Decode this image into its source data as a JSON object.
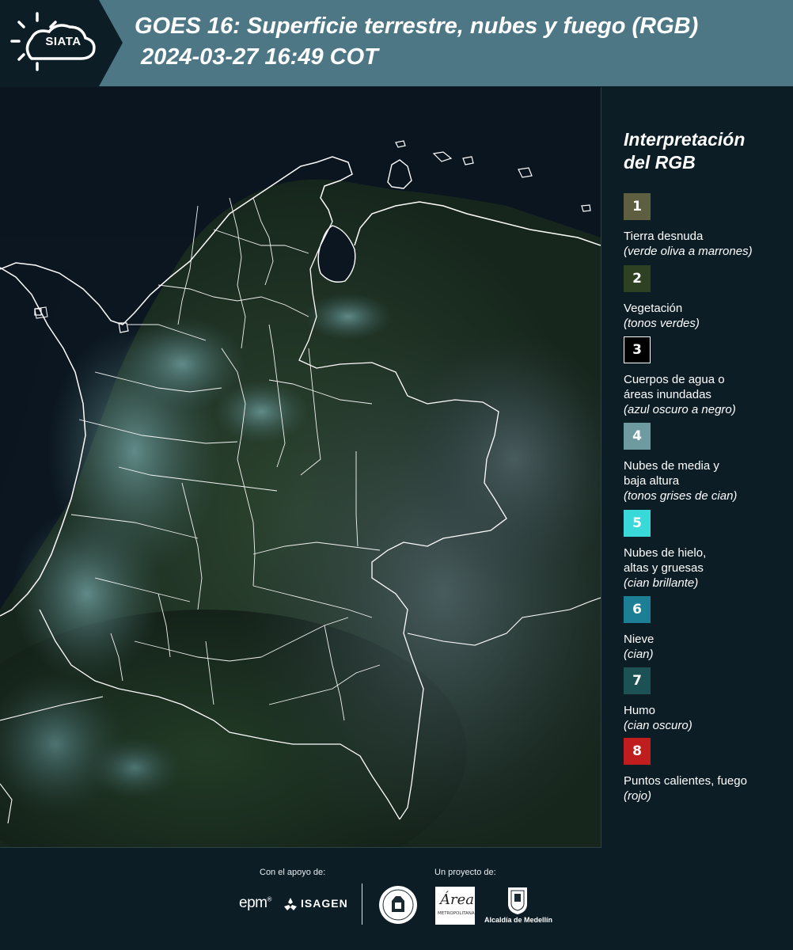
{
  "header": {
    "logo_text": "SIATA",
    "title_line1": "GOES 16: Superficie terrestre, nubes y fuego (RGB)",
    "title_line2": "2024-03-27 16:49 COT"
  },
  "legend": {
    "title_line1": "Interpretación",
    "title_line2": "del RGB",
    "items": [
      {
        "number": "1",
        "color": "#5e5e41",
        "name": "Tierra desnuda",
        "description": "(verde oliva a marrones)"
      },
      {
        "number": "2",
        "color": "#2e4122",
        "name": "Vegetación",
        "description": "(tonos verdes)"
      },
      {
        "number": "3",
        "color": "#000000",
        "name_line1": "Cuerpos de agua o",
        "name_line2": "áreas inundadas",
        "description": "(azul oscuro a negro)"
      },
      {
        "number": "4",
        "color": "#6e9ba0",
        "name_line1": "Nubes de media y",
        "name_line2": "baja altura",
        "description": "(tonos grises de cian)"
      },
      {
        "number": "5",
        "color": "#3ad9d9",
        "name_line1": "Nubes de hielo,",
        "name_line2": "altas y gruesas",
        "description": "(cian brillante)"
      },
      {
        "number": "6",
        "color": "#1d7f95",
        "name": "Nieve",
        "description": "(cian)"
      },
      {
        "number": "7",
        "color": "#1c5253",
        "name": "Humo",
        "description": "(cian oscuro)"
      },
      {
        "number": "8",
        "color": "#c01e1e",
        "name": "Puntos calientes, fuego",
        "description": "(rojo)"
      }
    ]
  },
  "footer": {
    "support_label": "Con el apoyo de:",
    "project_label": "Un proyecto de:",
    "epm": "epm",
    "isagen": "ISAGEN",
    "area_word": "Área",
    "area_sub": "METROPOLITANA",
    "alcaldia": "Alcaldía de Medellín"
  }
}
